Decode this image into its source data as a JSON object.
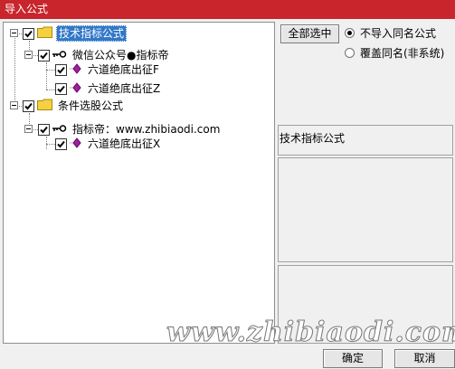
{
  "window": {
    "title": "导入公式"
  },
  "tree": {
    "nodes": [
      {
        "label": "技术指标公式",
        "selected": true,
        "checked": true
      },
      {
        "label": "微信公众号●指标帝",
        "checked": true
      },
      {
        "label": "六道绝底出征F",
        "checked": true
      },
      {
        "label": "六道绝底出征Z",
        "checked": true
      },
      {
        "label": "条件选股公式",
        "checked": true
      },
      {
        "label": "指标帝：www.zhibiaodi.com",
        "checked": true
      },
      {
        "label": "六道绝底出征X",
        "checked": true
      }
    ]
  },
  "options": {
    "select_all_label": "全部选中",
    "radio_no_import": "不导入同名公式",
    "radio_overwrite": "覆盖同名(非系统)",
    "selected_radio": "no_import"
  },
  "info": {
    "category_label": "技术指标公式"
  },
  "buttons": {
    "ok": "确定",
    "cancel": "取消"
  },
  "watermark": "www.zhibiaodi.com",
  "colors": {
    "titlebar": "#c8252c",
    "selection": "#3278c8",
    "folder": "#f5d040",
    "formula": "#a020a0"
  }
}
